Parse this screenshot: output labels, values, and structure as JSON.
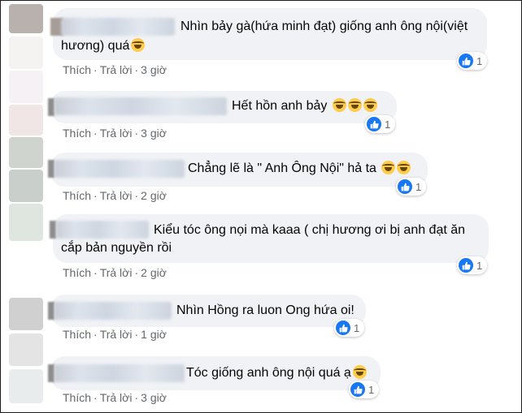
{
  "comments": [
    {
      "text_lines": [
        "Nhìn bảy gà(hứa minh đạt) giống anh ông nội(việt",
        "hương) quá"
      ],
      "emoji": "rofl",
      "actions": {
        "like": "Thích",
        "reply": "Trả lời",
        "time": "3 giờ"
      },
      "reaction_count": "1"
    },
    {
      "text_lines": [
        "Hết hồn anh bảy"
      ],
      "emoji": "rofl x3",
      "actions": {
        "like": "Thích",
        "reply": "Trả lời",
        "time": "3 giờ"
      },
      "reaction_count": "1"
    },
    {
      "text_lines": [
        "Chẳng lẽ là \" Anh Ông Nội\" hả ta"
      ],
      "emoji": "tears-of-joy x2",
      "actions": {
        "like": "Thích",
        "reply": "Trả lời",
        "time": "2 giờ"
      },
      "reaction_count": "1"
    },
    {
      "text_lines": [
        "Kiểu tóc ông nọi mà kaaa ( chị hương ơi bị anh đạt ăn",
        "cắp bản nguyền rồi"
      ],
      "emoji": "",
      "actions": {
        "like": "Thích",
        "reply": "Trả lời",
        "time": "2 giờ"
      },
      "reaction_count": "1"
    },
    {
      "text_lines": [
        "Nhìn Hồng ra luon Ong hứa oi!"
      ],
      "emoji": "",
      "actions": {
        "like": "Thích",
        "reply": "Trả lời",
        "time": "1 giờ"
      },
      "reaction_count": "1"
    },
    {
      "text_lines": [
        "Tóc giống anh ông nội quá ạ"
      ],
      "emoji": "tears-of-joy",
      "actions": {
        "like": "Thích",
        "reply": "Trả lời",
        "time": "3 giờ"
      },
      "reaction_count": "1"
    }
  ],
  "icons": {
    "reaction": "like-icon",
    "emoji": "laughing-face-icon"
  },
  "colors": {
    "bubble": "#f0f2f5",
    "like_blue": "#1877f2",
    "meta_text": "#65676b"
  }
}
